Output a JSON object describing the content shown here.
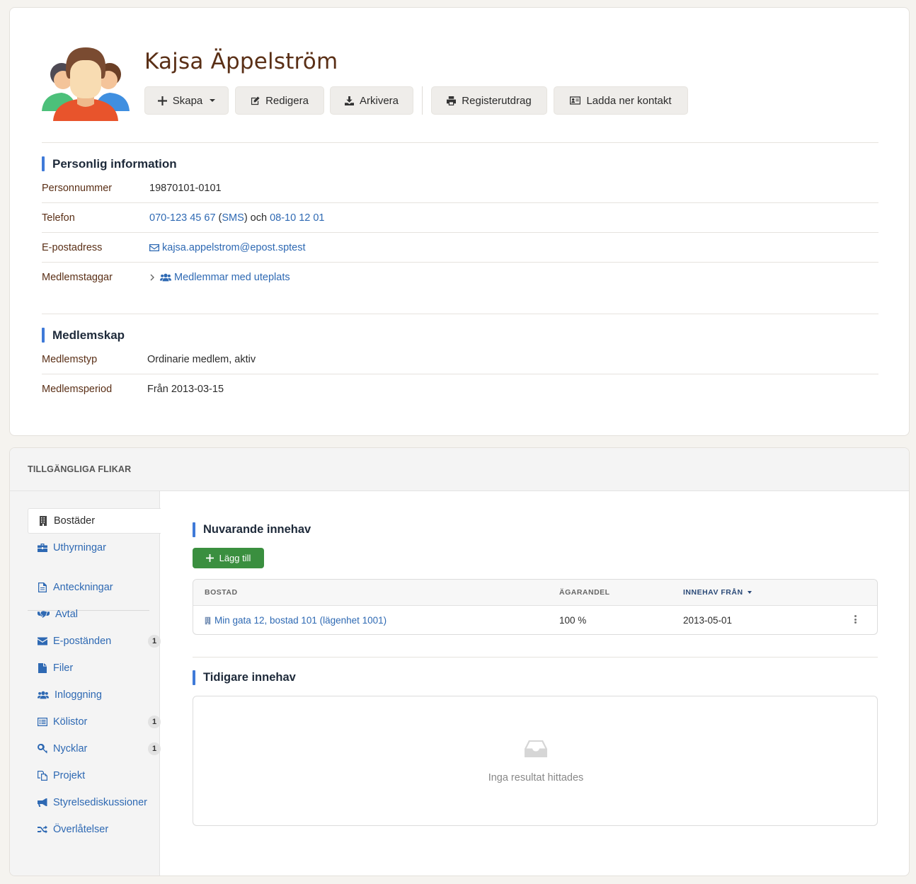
{
  "profile": {
    "name": "Kajsa Äppelström",
    "actions": {
      "skapa": "Skapa",
      "redigera": "Redigera",
      "arkivera": "Arkivera",
      "registerutdrag": "Registerutdrag",
      "ladda_ner_kontakt": "Ladda ner kontakt"
    }
  },
  "personal_info": {
    "title": "Personlig information",
    "personnummer_label": "Personnummer",
    "personnummer": "19870101-0101",
    "telefon_label": "Telefon",
    "phone1": "070-123 45 67",
    "sms_open": " (",
    "sms": "SMS",
    "sms_close": ") och ",
    "phone2": "08-10 12 01",
    "email_label": "E-postadress",
    "email": "kajsa.appelstrom@epost.sptest",
    "tags_label": "Medlemstaggar",
    "tag": "Medlemmar med uteplats"
  },
  "membership": {
    "title": "Medlemskap",
    "type_label": "Medlemstyp",
    "type": "Ordinarie medlem, aktiv",
    "period_label": "Medlemsperiod",
    "period": "Från 2013-03-15"
  },
  "tabs": {
    "heading": "TILLGÄNGLIGA FLIKAR",
    "items": [
      {
        "label": "Bostäder",
        "icon": "building-icon"
      },
      {
        "label": "Uthyrningar",
        "icon": "briefcase-icon"
      },
      {
        "label": "Anteckningar",
        "icon": "note-icon"
      },
      {
        "label": "Avtal",
        "icon": "handshake-icon"
      },
      {
        "label": "E-poständen",
        "icon": "envelope-icon",
        "badge": "1"
      },
      {
        "label": "Filer",
        "icon": "file-icon"
      },
      {
        "label": "Inloggning",
        "icon": "users-icon"
      },
      {
        "label": "Kölistor",
        "icon": "list-icon",
        "badge": "1"
      },
      {
        "label": "Nycklar",
        "icon": "key-icon",
        "badge": "1"
      },
      {
        "label": "Projekt",
        "icon": "copy-icon"
      },
      {
        "label": "Styrelsediskussioner",
        "icon": "megaphone-icon"
      },
      {
        "label": "Överlåtelser",
        "icon": "shuffle-icon"
      }
    ]
  },
  "current_holdings": {
    "title": "Nuvarande innehav",
    "add_button": "Lägg till",
    "columns": [
      "BOSTAD",
      "ÄGARANDEL",
      "INNEHAV FRÅN"
    ],
    "rows": [
      {
        "bostad": "Min gata 12, bostad 101 (lägenhet 1001)",
        "agarandel": "100 %",
        "innehav_fran": "2013-05-01"
      }
    ]
  },
  "previous_holdings": {
    "title": "Tidigare innehav",
    "empty_text": "Inga resultat hittades"
  },
  "colors": {
    "accent_blue": "#3f7ad8",
    "link_blue": "#2e69b3",
    "name_brown": "#5a2f16",
    "add_green": "#3a8f3f"
  }
}
